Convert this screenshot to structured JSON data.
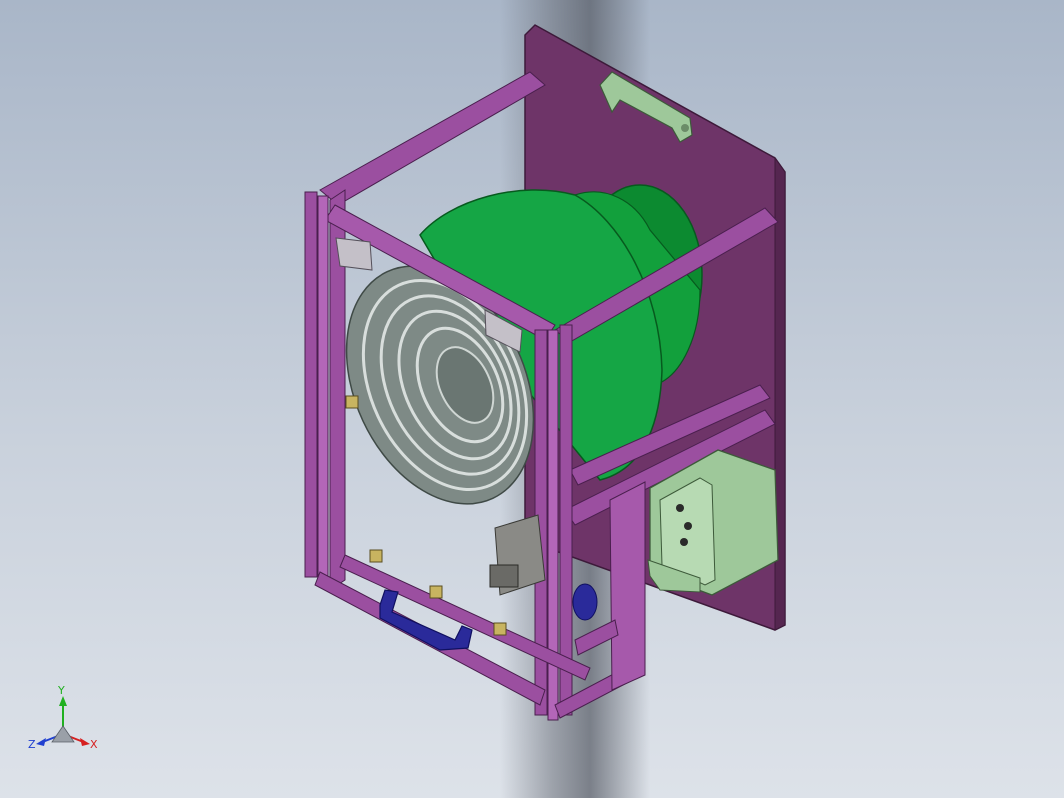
{
  "viewport": {
    "background_top": "#a9b6c8",
    "background_bottom": "#dde2e9"
  },
  "model": {
    "frame_color": "#9b4fa0",
    "frame_dark": "#6b2f72",
    "plate_color": "#6e3468",
    "fan_color": "#14a040",
    "fan_dark": "#0c7a2c",
    "bracket_color": "#9ec89a",
    "handle_color": "#2a2a9a",
    "nut_color": "#c8b460"
  },
  "triad": {
    "x_label": "X",
    "y_label": "Y",
    "z_label": "Z",
    "x_color": "#d62020",
    "y_color": "#20b020",
    "z_color": "#2040d0"
  }
}
